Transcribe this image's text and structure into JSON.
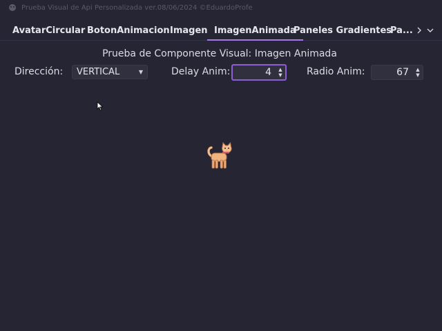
{
  "window": {
    "title": "Prueba Visual de Api Personalizada ver.08/06/2024 ©EduardoProfe"
  },
  "tabs": [
    {
      "label": "AvatarCircular"
    },
    {
      "label": "BotonAnimacion"
    },
    {
      "label": "Imagen"
    },
    {
      "label": "ImagenAnimada"
    },
    {
      "label": "Paneles Gradientes"
    },
    {
      "label": "Pa..."
    }
  ],
  "selected_tab": "ImagenAnimada",
  "panel": {
    "heading": "Prueba de Componente Visual: Imagen Animada",
    "direction_label": "Dirección:",
    "direction_value": "VERTICAL",
    "delay_label": "Delay Anim:",
    "delay_value": "4",
    "radius_label": "Radio Anim:",
    "radius_value": "67"
  },
  "icons": {
    "app": "app-icon",
    "tab_next": "chevron-right-icon",
    "tab_list": "chevron-down-icon",
    "combo_arrow": "triangle-down-icon",
    "animated_image": "cat-icon",
    "cursor": "mouse-cursor-icon"
  },
  "colors": {
    "background": "#262533",
    "accent": "#a877e8",
    "text": "#dcdce5",
    "field_bg": "#31303f"
  }
}
